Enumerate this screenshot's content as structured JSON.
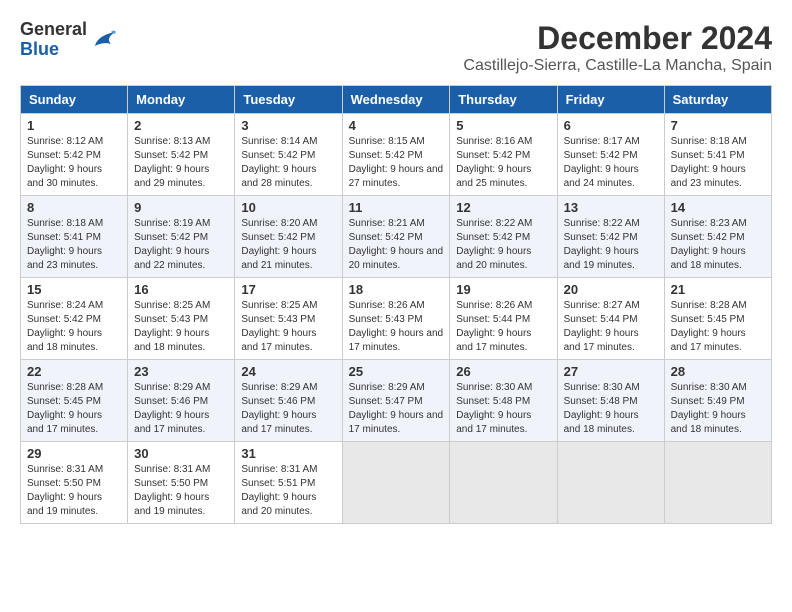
{
  "logo": {
    "general": "General",
    "blue": "Blue"
  },
  "title": "December 2024",
  "subtitle": "Castillejo-Sierra, Castille-La Mancha, Spain",
  "days": [
    "Sunday",
    "Monday",
    "Tuesday",
    "Wednesday",
    "Thursday",
    "Friday",
    "Saturday"
  ],
  "weeks": [
    [
      {
        "day": "1",
        "sunrise": "Sunrise: 8:12 AM",
        "sunset": "Sunset: 5:42 PM",
        "daylight": "Daylight: 9 hours and 30 minutes."
      },
      {
        "day": "2",
        "sunrise": "Sunrise: 8:13 AM",
        "sunset": "Sunset: 5:42 PM",
        "daylight": "Daylight: 9 hours and 29 minutes."
      },
      {
        "day": "3",
        "sunrise": "Sunrise: 8:14 AM",
        "sunset": "Sunset: 5:42 PM",
        "daylight": "Daylight: 9 hours and 28 minutes."
      },
      {
        "day": "4",
        "sunrise": "Sunrise: 8:15 AM",
        "sunset": "Sunset: 5:42 PM",
        "daylight": "Daylight: 9 hours and 27 minutes."
      },
      {
        "day": "5",
        "sunrise": "Sunrise: 8:16 AM",
        "sunset": "Sunset: 5:42 PM",
        "daylight": "Daylight: 9 hours and 25 minutes."
      },
      {
        "day": "6",
        "sunrise": "Sunrise: 8:17 AM",
        "sunset": "Sunset: 5:42 PM",
        "daylight": "Daylight: 9 hours and 24 minutes."
      },
      {
        "day": "7",
        "sunrise": "Sunrise: 8:18 AM",
        "sunset": "Sunset: 5:41 PM",
        "daylight": "Daylight: 9 hours and 23 minutes."
      }
    ],
    [
      {
        "day": "8",
        "sunrise": "Sunrise: 8:18 AM",
        "sunset": "Sunset: 5:41 PM",
        "daylight": "Daylight: 9 hours and 23 minutes."
      },
      {
        "day": "9",
        "sunrise": "Sunrise: 8:19 AM",
        "sunset": "Sunset: 5:42 PM",
        "daylight": "Daylight: 9 hours and 22 minutes."
      },
      {
        "day": "10",
        "sunrise": "Sunrise: 8:20 AM",
        "sunset": "Sunset: 5:42 PM",
        "daylight": "Daylight: 9 hours and 21 minutes."
      },
      {
        "day": "11",
        "sunrise": "Sunrise: 8:21 AM",
        "sunset": "Sunset: 5:42 PM",
        "daylight": "Daylight: 9 hours and 20 minutes."
      },
      {
        "day": "12",
        "sunrise": "Sunrise: 8:22 AM",
        "sunset": "Sunset: 5:42 PM",
        "daylight": "Daylight: 9 hours and 20 minutes."
      },
      {
        "day": "13",
        "sunrise": "Sunrise: 8:22 AM",
        "sunset": "Sunset: 5:42 PM",
        "daylight": "Daylight: 9 hours and 19 minutes."
      },
      {
        "day": "14",
        "sunrise": "Sunrise: 8:23 AM",
        "sunset": "Sunset: 5:42 PM",
        "daylight": "Daylight: 9 hours and 18 minutes."
      }
    ],
    [
      {
        "day": "15",
        "sunrise": "Sunrise: 8:24 AM",
        "sunset": "Sunset: 5:42 PM",
        "daylight": "Daylight: 9 hours and 18 minutes."
      },
      {
        "day": "16",
        "sunrise": "Sunrise: 8:25 AM",
        "sunset": "Sunset: 5:43 PM",
        "daylight": "Daylight: 9 hours and 18 minutes."
      },
      {
        "day": "17",
        "sunrise": "Sunrise: 8:25 AM",
        "sunset": "Sunset: 5:43 PM",
        "daylight": "Daylight: 9 hours and 17 minutes."
      },
      {
        "day": "18",
        "sunrise": "Sunrise: 8:26 AM",
        "sunset": "Sunset: 5:43 PM",
        "daylight": "Daylight: 9 hours and 17 minutes."
      },
      {
        "day": "19",
        "sunrise": "Sunrise: 8:26 AM",
        "sunset": "Sunset: 5:44 PM",
        "daylight": "Daylight: 9 hours and 17 minutes."
      },
      {
        "day": "20",
        "sunrise": "Sunrise: 8:27 AM",
        "sunset": "Sunset: 5:44 PM",
        "daylight": "Daylight: 9 hours and 17 minutes."
      },
      {
        "day": "21",
        "sunrise": "Sunrise: 8:28 AM",
        "sunset": "Sunset: 5:45 PM",
        "daylight": "Daylight: 9 hours and 17 minutes."
      }
    ],
    [
      {
        "day": "22",
        "sunrise": "Sunrise: 8:28 AM",
        "sunset": "Sunset: 5:45 PM",
        "daylight": "Daylight: 9 hours and 17 minutes."
      },
      {
        "day": "23",
        "sunrise": "Sunrise: 8:29 AM",
        "sunset": "Sunset: 5:46 PM",
        "daylight": "Daylight: 9 hours and 17 minutes."
      },
      {
        "day": "24",
        "sunrise": "Sunrise: 8:29 AM",
        "sunset": "Sunset: 5:46 PM",
        "daylight": "Daylight: 9 hours and 17 minutes."
      },
      {
        "day": "25",
        "sunrise": "Sunrise: 8:29 AM",
        "sunset": "Sunset: 5:47 PM",
        "daylight": "Daylight: 9 hours and 17 minutes."
      },
      {
        "day": "26",
        "sunrise": "Sunrise: 8:30 AM",
        "sunset": "Sunset: 5:48 PM",
        "daylight": "Daylight: 9 hours and 17 minutes."
      },
      {
        "day": "27",
        "sunrise": "Sunrise: 8:30 AM",
        "sunset": "Sunset: 5:48 PM",
        "daylight": "Daylight: 9 hours and 18 minutes."
      },
      {
        "day": "28",
        "sunrise": "Sunrise: 8:30 AM",
        "sunset": "Sunset: 5:49 PM",
        "daylight": "Daylight: 9 hours and 18 minutes."
      }
    ],
    [
      {
        "day": "29",
        "sunrise": "Sunrise: 8:31 AM",
        "sunset": "Sunset: 5:50 PM",
        "daylight": "Daylight: 9 hours and 19 minutes."
      },
      {
        "day": "30",
        "sunrise": "Sunrise: 8:31 AM",
        "sunset": "Sunset: 5:50 PM",
        "daylight": "Daylight: 9 hours and 19 minutes."
      },
      {
        "day": "31",
        "sunrise": "Sunrise: 8:31 AM",
        "sunset": "Sunset: 5:51 PM",
        "daylight": "Daylight: 9 hours and 20 minutes."
      },
      null,
      null,
      null,
      null
    ]
  ]
}
